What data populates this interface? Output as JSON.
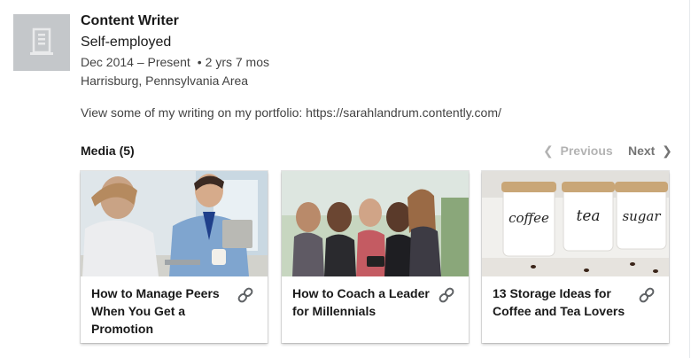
{
  "experience": {
    "title": "Content Writer",
    "company": "Self-employed",
    "date_range": "Dec 2014 – Present",
    "separator": "•",
    "duration": "2 yrs 7 mos",
    "location": "Harrisburg, Pennsylvania Area",
    "description": "View some of my writing on my portfolio: https://sarahlandrum.contently.com/"
  },
  "media": {
    "header": "Media (5)",
    "previous_label": "Previous",
    "next_label": "Next",
    "items": [
      {
        "caption": "How to Manage Peers When You Get a Promotion",
        "icon": "link-icon"
      },
      {
        "caption": "How to Coach a Leader for Millennials",
        "icon": "link-icon"
      },
      {
        "caption": "13 Storage Ideas for Coffee and Tea Lovers",
        "icon": "link-icon"
      }
    ],
    "jar_labels": [
      "coffee",
      "tea",
      "sugar"
    ]
  },
  "colors": {
    "logo_bg": "#c4c7ca",
    "text_primary": "rgba(0,0,0,0.9)",
    "text_secondary": "rgba(0,0,0,0.75)"
  }
}
